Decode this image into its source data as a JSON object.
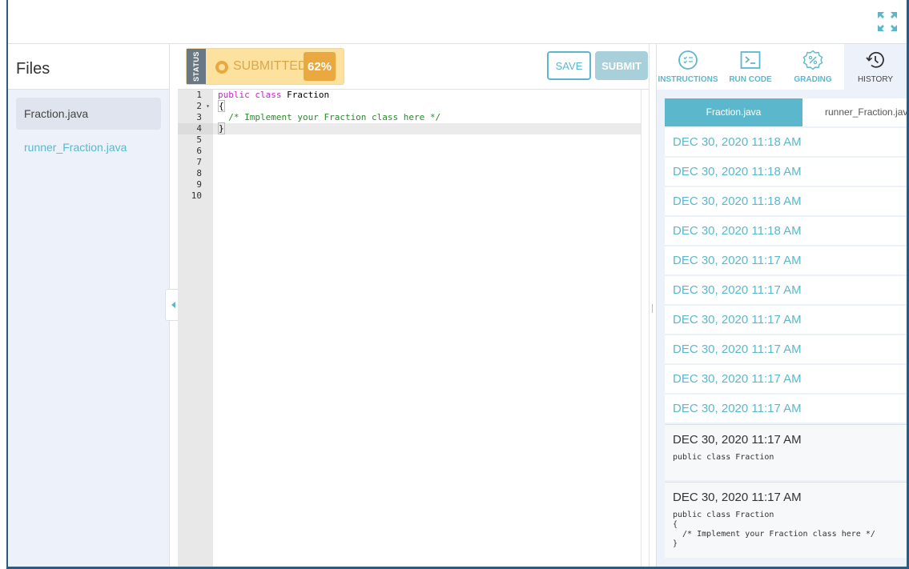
{
  "top": {
    "expand_icon": "expand-arrows-icon"
  },
  "files": {
    "title": "Files",
    "items": [
      {
        "label": "Fraction.java",
        "active": true
      },
      {
        "label": "runner_Fraction.java",
        "active": false
      }
    ]
  },
  "editor": {
    "status_tab": "STATUS",
    "status_text": "SUBMITTED",
    "score": "62%",
    "save_label": "SAVE",
    "submit_label": "SUBMIT",
    "line_numbers": [
      "1",
      "2",
      "3",
      "4",
      "5",
      "6",
      "7",
      "8",
      "9",
      "10"
    ],
    "code": {
      "l1_kw1": "public",
      "l1_kw2": "class",
      "l1_name": " Fraction",
      "l2": "{",
      "l3": "  /* Implement your Fraction class here */",
      "l4": "}"
    }
  },
  "right": {
    "tabs": [
      {
        "label": "INSTRUCTIONS",
        "icon": "checklist-icon"
      },
      {
        "label": "RUN CODE",
        "icon": "terminal-icon"
      },
      {
        "label": "GRADING",
        "icon": "percent-badge-icon"
      },
      {
        "label": "HISTORY",
        "icon": "history-icon",
        "active": true
      }
    ],
    "file_tabs": [
      {
        "label": "Fraction.java",
        "active": true
      },
      {
        "label": "runner_Fraction.java",
        "active": false
      }
    ],
    "history": [
      "DEC 30, 2020 11:18 AM",
      "DEC 30, 2020 11:18 AM",
      "DEC 30, 2020 11:18 AM",
      "DEC 30, 2020 11:18 AM",
      "DEC 30, 2020 11:17 AM",
      "DEC 30, 2020 11:17 AM",
      "DEC 30, 2020 11:17 AM",
      "DEC 30, 2020 11:17 AM",
      "DEC 30, 2020 11:17 AM",
      "DEC 30, 2020 11:17 AM"
    ],
    "cards": [
      {
        "title": "DEC 30, 2020 11:17 AM",
        "code": "public class Fraction"
      },
      {
        "title": "DEC 30, 2020 11:17 AM",
        "code": "public class Fraction\n{\n  /* Implement your Fraction class here */\n}"
      }
    ]
  },
  "colors": {
    "accent": "#5bb8cc",
    "status_bg": "#fce19f",
    "score_bg": "#eaa940",
    "frame": "#2f5a80"
  }
}
